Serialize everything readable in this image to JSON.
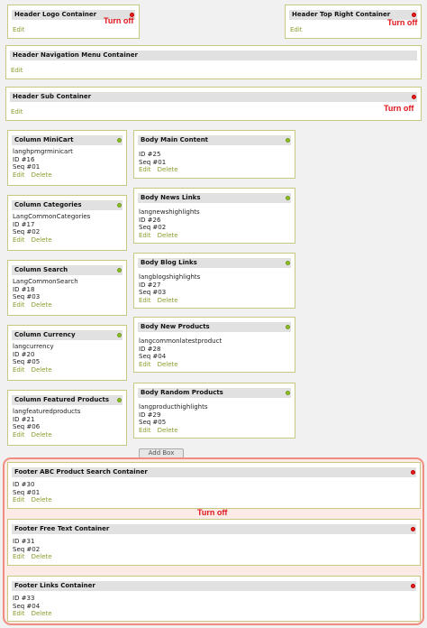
{
  "annotation": "Turn off",
  "actions": {
    "edit": "Edit",
    "delete": "Delete"
  },
  "add_box": "Add Box",
  "header": {
    "logo": {
      "title": "Header Logo Container",
      "status": "red"
    },
    "top_right": {
      "title": "Header Top Right Container",
      "status": "red"
    },
    "nav": {
      "title": "Header Navigation Menu Container"
    },
    "sub": {
      "title": "Header Sub Container",
      "status": "red"
    }
  },
  "columns": [
    {
      "title": "Column MiniCart",
      "lang": "langhpmgrminicart",
      "id": "ID #16",
      "seq": "Seq #01",
      "status": "green"
    },
    {
      "title": "Column Categories",
      "lang": "LangCommonCategories",
      "id": "ID #17",
      "seq": "Seq #02",
      "status": "green"
    },
    {
      "title": "Column Search",
      "lang": "LangCommonSearch",
      "id": "ID #18",
      "seq": "Seq #03",
      "status": "green"
    },
    {
      "title": "Column Currency",
      "lang": "langcurrency",
      "id": "ID #20",
      "seq": "Seq #05",
      "status": "green"
    },
    {
      "title": "Column Featured Products",
      "lang": "langfeaturedproducts",
      "id": "ID #21",
      "seq": "Seq #06",
      "status": "green"
    }
  ],
  "bodies": [
    {
      "title": "Body Main Content",
      "lang": "",
      "id": "ID #25",
      "seq": "Seq #01",
      "status": "green"
    },
    {
      "title": "Body News Links",
      "lang": "langnewshighlights",
      "id": "ID #26",
      "seq": "Seq #02",
      "status": "green"
    },
    {
      "title": "Body Blog Links",
      "lang": "langblogshighlights",
      "id": "ID #27",
      "seq": "Seq #03",
      "status": "green"
    },
    {
      "title": "Body New Products",
      "lang": "langcommonlatestproduct",
      "id": "ID #28",
      "seq": "Seq #04",
      "status": "green"
    },
    {
      "title": "Body Random Products",
      "lang": "langproducthighlights",
      "id": "ID #29",
      "seq": "Seq #05",
      "status": "green"
    }
  ],
  "footers": [
    {
      "title": "Footer ABC Product Search Container",
      "id": "ID #30",
      "seq": "Seq #01",
      "status": "red"
    },
    {
      "title": "Footer Free Text Container",
      "id": "ID #31",
      "seq": "Seq #02",
      "status": "red"
    },
    {
      "title": "Footer Links Container",
      "id": "ID #33",
      "seq": "Seq #04",
      "status": "red"
    }
  ],
  "colors": {
    "border": "#c7c982",
    "link": "#8a9c2b",
    "header_bar": "#e1e1e1",
    "on": "#8fbf2a",
    "off": "#e8201f",
    "annotation": "#e0141b",
    "highlight": "#ef8e80"
  }
}
